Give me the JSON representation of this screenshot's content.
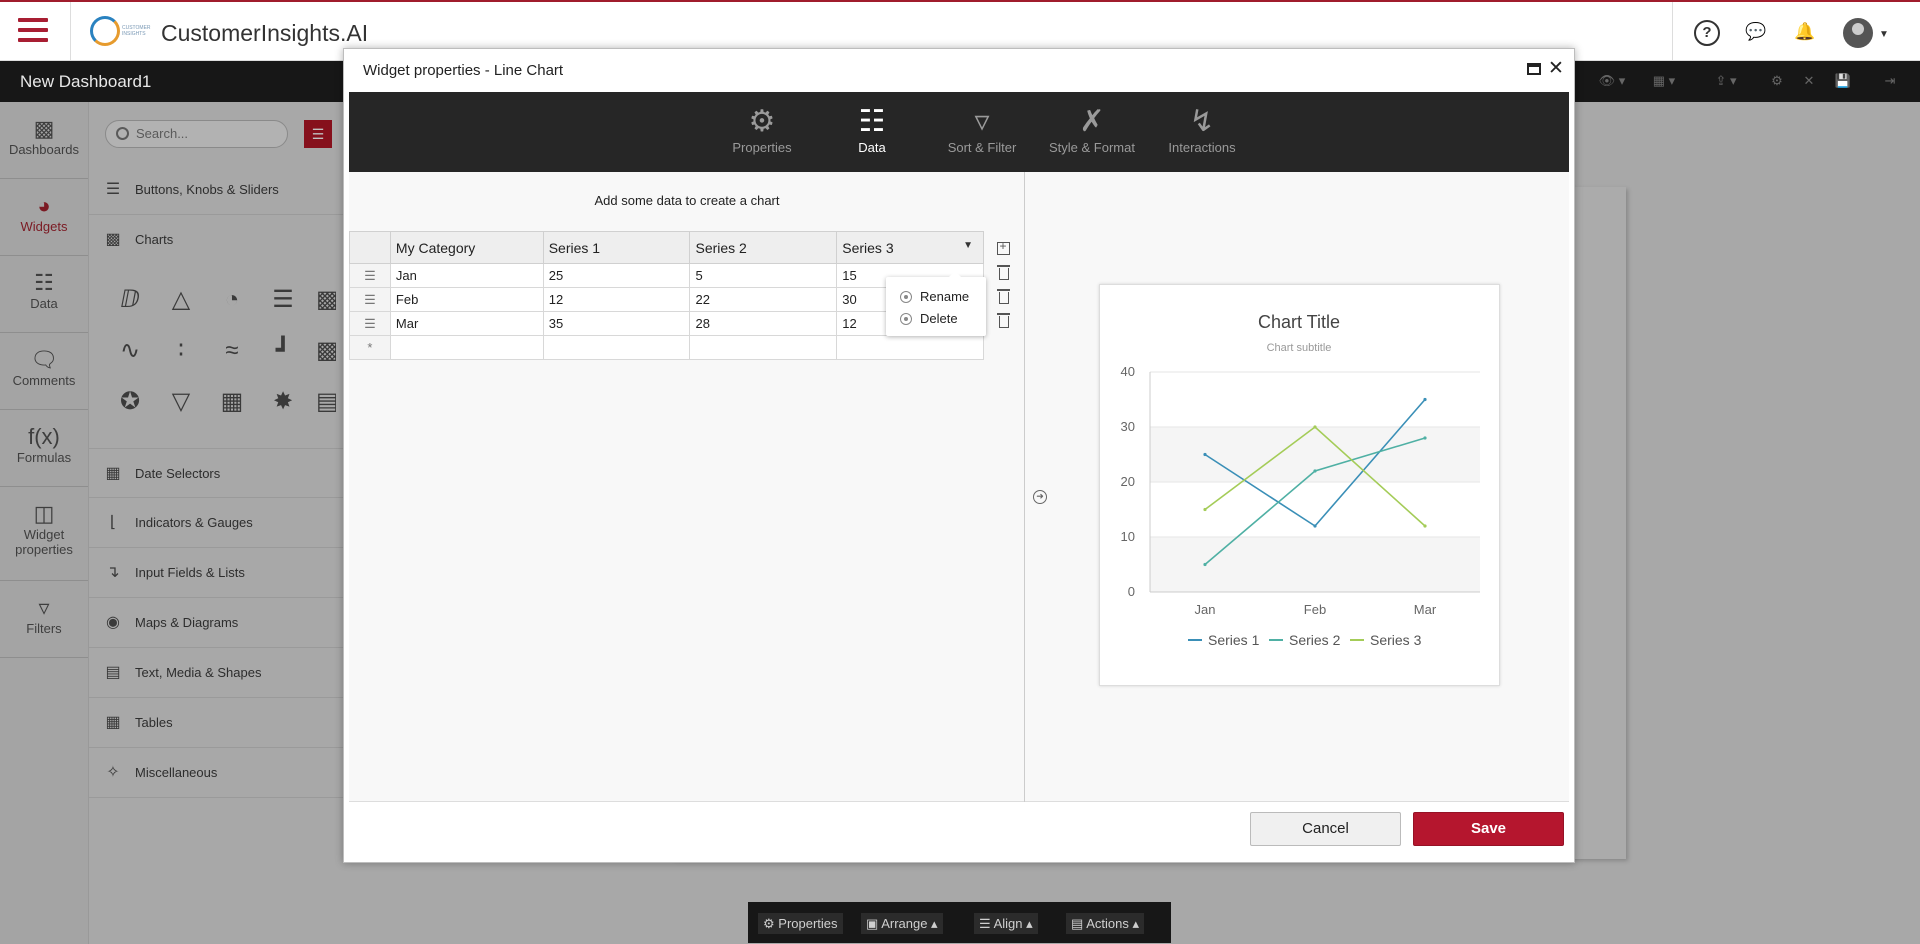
{
  "app": {
    "title": "CustomerInsights.AI",
    "logo_text": "CUSTOMER INSIGHTS"
  },
  "dashboard": {
    "name": "New Dashboard1"
  },
  "sidebar": {
    "items": [
      {
        "label": "Dashboards",
        "icon": "bar-chart-icon"
      },
      {
        "label": "Widgets",
        "icon": "gauge-icon",
        "active": true
      },
      {
        "label": "Data",
        "icon": "database-icon"
      },
      {
        "label": "Comments",
        "icon": "comments-icon"
      },
      {
        "label": "Formulas",
        "icon": "function-icon",
        "glyph": "f(x)"
      },
      {
        "label": "Widget properties",
        "icon": "layout-icon"
      },
      {
        "label": "Filters",
        "icon": "filter-icon"
      }
    ]
  },
  "panel": {
    "search_placeholder": "Search...",
    "categories": [
      "Buttons, Knobs & Sliders",
      "Charts",
      "Date Selectors",
      "Indicators & Gauges",
      "Input Fields & Lists",
      "Maps & Diagrams",
      "Text, Media & Shapes",
      "Tables",
      "Miscellaneous"
    ]
  },
  "modal": {
    "title": "Widget properties - Line Chart",
    "tabs": [
      "Properties",
      "Data",
      "Sort & Filter",
      "Style & Format",
      "Interactions"
    ],
    "active_tab": "Data",
    "grid_message": "Add some data to create a chart",
    "columns": [
      "My Category",
      "Series 1",
      "Series 2",
      "Series 3"
    ],
    "rows": [
      [
        "Jan",
        "25",
        "5",
        "15"
      ],
      [
        "Feb",
        "12",
        "22",
        "30"
      ],
      [
        "Mar",
        "35",
        "28",
        "12"
      ]
    ],
    "new_row_marker": "*",
    "context_menu": [
      "Rename",
      "Delete"
    ],
    "cancel_label": "Cancel",
    "save_label": "Save"
  },
  "chart_data": {
    "type": "line",
    "title": "Chart Title",
    "subtitle": "Chart subtitle",
    "categories": [
      "Jan",
      "Feb",
      "Mar"
    ],
    "series": [
      {
        "name": "Series 1",
        "values": [
          25,
          12,
          35
        ],
        "color": "#3a8fb7"
      },
      {
        "name": "Series 2",
        "values": [
          5,
          22,
          28
        ],
        "color": "#4fb0a4"
      },
      {
        "name": "Series 3",
        "values": [
          15,
          30,
          12
        ],
        "color": "#a4cc58"
      }
    ],
    "ylim": [
      0,
      40
    ],
    "yticks": [
      "0",
      "10",
      "20",
      "30",
      "40"
    ],
    "grid": true,
    "legend": "bottom"
  },
  "bottombar": {
    "items": [
      "Properties",
      "Arrange",
      "Align",
      "Actions"
    ]
  }
}
